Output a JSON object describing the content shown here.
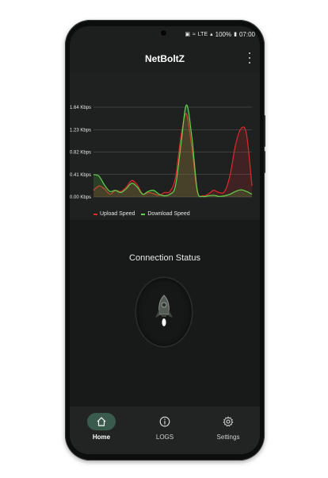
{
  "app": {
    "title": "NetBoltZ"
  },
  "status_bar": {
    "battery": "100%",
    "time": "07:00",
    "network": "LTE"
  },
  "chart_data": {
    "type": "line",
    "x": [
      0,
      1,
      2,
      3,
      4,
      5,
      6,
      7,
      8,
      9,
      10,
      11,
      12,
      13,
      14,
      15,
      16,
      17,
      18,
      19,
      20,
      21,
      22,
      23,
      24,
      25,
      26,
      27,
      28,
      29
    ],
    "series": [
      {
        "name": "Upload Speed",
        "color": "#e0282b",
        "values": [
          0.12,
          0.2,
          0.15,
          0.05,
          0.12,
          0.1,
          0.18,
          0.3,
          0.22,
          0.05,
          0.08,
          0.06,
          0.03,
          0.08,
          0.1,
          0.35,
          1.1,
          1.52,
          0.9,
          0.1,
          0.02,
          0.05,
          0.12,
          0.08,
          0.1,
          0.4,
          0.95,
          1.25,
          1.15,
          0.2
        ]
      },
      {
        "name": "Download Speed",
        "color": "#5fd34a",
        "values": [
          0.41,
          0.38,
          0.22,
          0.1,
          0.12,
          0.08,
          0.15,
          0.25,
          0.18,
          0.05,
          0.1,
          0.12,
          0.05,
          0.02,
          0.05,
          0.2,
          0.95,
          1.68,
          1.1,
          0.12,
          0.01,
          0.02,
          0.03,
          0.01,
          0.02,
          0.05,
          0.1,
          0.13,
          0.1,
          0.05
        ]
      }
    ],
    "y_ticks": [
      "1.64 Kbps",
      "1.23 Kbps",
      "0.82 Kbps",
      "0.41 Kbps",
      "0.00 Kbps"
    ],
    "ylim": [
      0,
      1.64
    ],
    "grid": true,
    "legend": "bottom-left"
  },
  "connection": {
    "label": "Connection Status"
  },
  "nav": {
    "items": [
      {
        "label": "Home",
        "icon": "home-icon",
        "active": true
      },
      {
        "label": "LOGS",
        "icon": "info-icon",
        "active": false
      },
      {
        "label": "Settings",
        "icon": "gear-icon",
        "active": false
      }
    ]
  },
  "colors": {
    "accent": "#3a5a4d",
    "background": "#1d1f1e"
  }
}
